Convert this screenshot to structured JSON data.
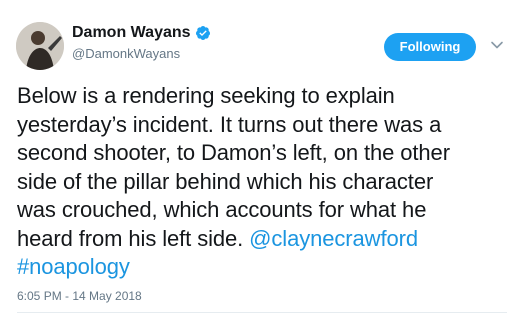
{
  "author": {
    "display_name": "Damon Wayans",
    "handle": "@DamonkWayans",
    "verified": true
  },
  "follow_button": {
    "label": "Following"
  },
  "icons": {
    "verified": "verified-badge-icon",
    "caret": "chevron-down-icon"
  },
  "tweet": {
    "text_lines": [
      "Below is a rendering seeking to explain",
      "yesterday’s incident.  It turns out there was a",
      "second shooter, to Damon’s left, on the other",
      "side of the pillar behind which his character",
      "was crouched, which accounts for what he",
      "heard from his left side. "
    ],
    "mention": "@claynecrawford",
    "hashtag": "#noapology",
    "timestamp": "6:05 PM - 14 May 2018"
  },
  "colors": {
    "accent": "#1da1f2",
    "link": "#1b95e0",
    "secondary_text": "#657786"
  }
}
